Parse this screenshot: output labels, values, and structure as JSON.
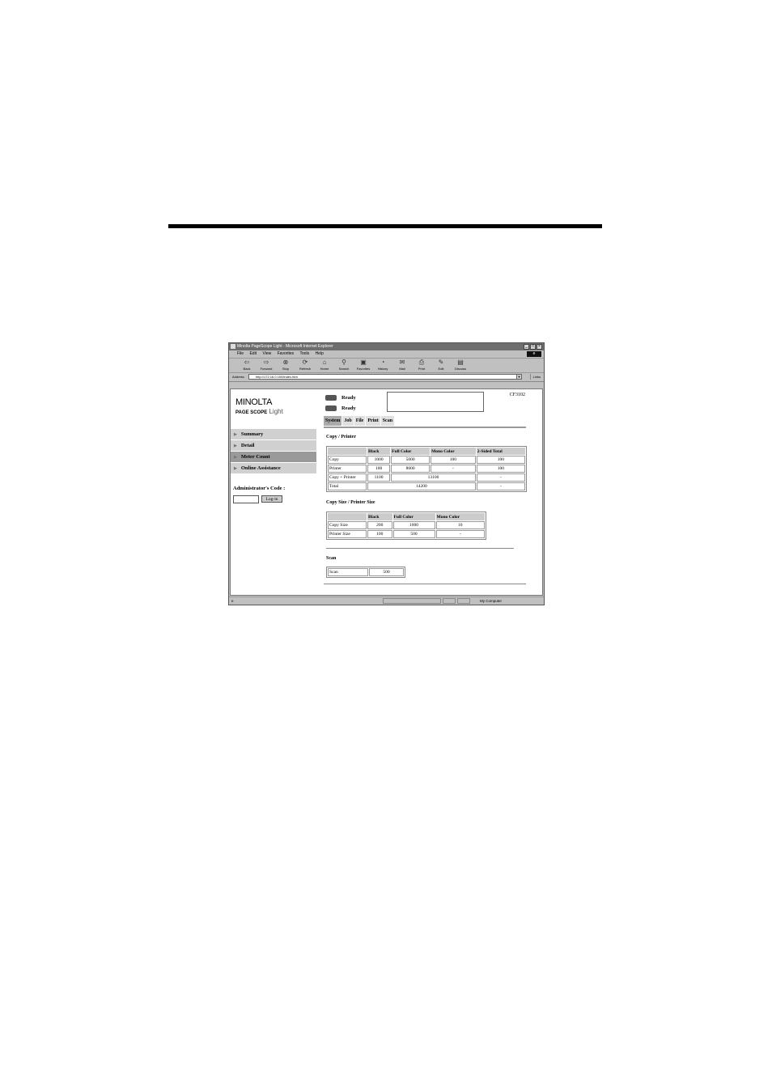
{
  "browser": {
    "title": "Minolta PageScope Light - Microsoft Internet Explorer",
    "menu": [
      "File",
      "Edit",
      "View",
      "Favorites",
      "Tools",
      "Help"
    ],
    "toolbar": [
      {
        "label": "Back",
        "icon": "back-arrow-icon"
      },
      {
        "label": "Forward",
        "icon": "forward-arrow-icon"
      },
      {
        "label": "Stop",
        "icon": "stop-icon"
      },
      {
        "label": "Refresh",
        "icon": "refresh-icon"
      },
      {
        "label": "Home",
        "icon": "home-icon"
      },
      {
        "label": "Search",
        "icon": "search-icon"
      },
      {
        "label": "Favorites",
        "icon": "favorites-icon"
      },
      {
        "label": "History",
        "icon": "history-icon"
      },
      {
        "label": "Mail",
        "icon": "mail-icon"
      },
      {
        "label": "Print",
        "icon": "print-icon"
      },
      {
        "label": "Edit",
        "icon": "edit-icon"
      },
      {
        "label": "Discuss",
        "icon": "discuss-icon"
      }
    ],
    "address_label": "Address",
    "address_url": "http://172.16.0.100/index.htm",
    "links_label": "Links",
    "status_zone": "My Computer"
  },
  "app": {
    "logo_brand": "MINOLTA",
    "logo_product": "Light",
    "logo_badge": "PAGE SCOPE",
    "nav": [
      {
        "label": "Summary",
        "active": false
      },
      {
        "label": "Detail",
        "active": false
      },
      {
        "label": "Meter Count",
        "active": true
      },
      {
        "label": "Online Assistance",
        "active": false
      }
    ],
    "admin_label": "Administrator's Code :",
    "login_button": "Log-in",
    "status": [
      "Ready",
      "Ready"
    ],
    "model": "CF3102",
    "tabs": [
      {
        "label": "System",
        "active": true
      },
      {
        "label": "Job",
        "active": false
      },
      {
        "label": "File",
        "active": false
      },
      {
        "label": "Print",
        "active": false
      },
      {
        "label": "Scan",
        "active": false
      }
    ],
    "copy_printer": {
      "title": "Copy / Printer",
      "headers": [
        "",
        "Black",
        "Full Color",
        "Mono Color",
        "2-Sided Total"
      ],
      "rows": [
        {
          "label": "Copy",
          "black": "1000",
          "full": "5000",
          "mono": "100",
          "sided": "100"
        },
        {
          "label": "Printer",
          "black": "100",
          "full": "8000",
          "mono": "-",
          "sided": "100"
        },
        {
          "label": "Copy + Printer",
          "black": "1100",
          "fullmono": "13100",
          "sided": "-"
        },
        {
          "label": "Total",
          "all": "14200",
          "sided": "-"
        }
      ]
    },
    "size": {
      "title": "Copy Size / Printer Size",
      "headers": [
        "",
        "Black",
        "Full Color",
        "Mono Color"
      ],
      "rows": [
        {
          "label": "Copy Size",
          "black": "200",
          "full": "1000",
          "mono": "10"
        },
        {
          "label": "Printer Size",
          "black": "100",
          "full": "500",
          "mono": "-"
        }
      ]
    },
    "scan": {
      "title": "Scan",
      "rows": [
        {
          "label": "Scan",
          "value": "500"
        }
      ]
    }
  }
}
